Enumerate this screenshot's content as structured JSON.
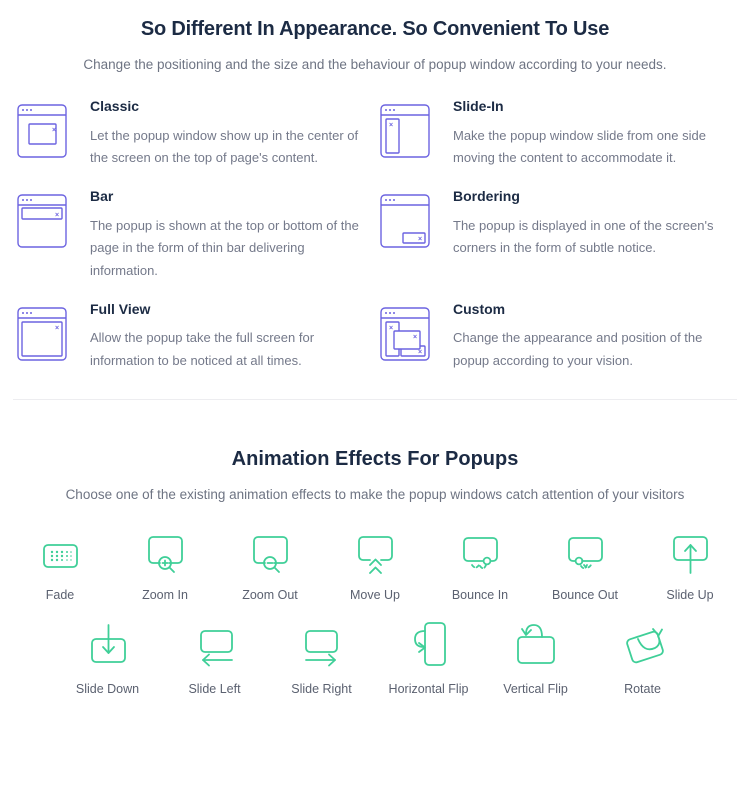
{
  "theme": {
    "icon_blue": "#6c63e0",
    "icon_green": "#3fcf98",
    "heading_color": "#1c2b44",
    "body_color": "#74798a"
  },
  "popup_section": {
    "title": "So Different In Appearance. So Convenient To Use",
    "subtitle": "Change the positioning and the size and the behaviour of popup window according to your needs.",
    "features": [
      {
        "icon": "browser-window-center-popup-icon",
        "title": "Classic",
        "description": "Let the popup window show up in the center of the screen on the top of page's content."
      },
      {
        "icon": "browser-window-side-panel-icon",
        "title": "Slide-In",
        "description": "Make the popup window slide from one side moving the content to accommodate it."
      },
      {
        "icon": "browser-window-top-bar-icon",
        "title": "Bar",
        "description": "The popup is shown at the top or bottom of the page in the form of thin bar delivering information."
      },
      {
        "icon": "browser-window-corner-notice-icon",
        "title": "Bordering",
        "description": "The popup is displayed in one of the screen's corners in the form of subtle notice."
      },
      {
        "icon": "browser-window-fullscreen-icon",
        "title": "Full View",
        "description": "Allow the popup take the full screen for information to be noticed at all times."
      },
      {
        "icon": "browser-window-multi-popup-icon",
        "title": "Custom",
        "description": "Change the appearance and position of the popup according to your vision."
      }
    ]
  },
  "animation_section": {
    "title": "Animation Effects For Popups",
    "subtitle": "Choose one of the existing animation effects to make the popup windows catch attention of your visitors",
    "rows": [
      [
        {
          "icon": "fade-dots-icon",
          "label": "Fade"
        },
        {
          "icon": "zoom-in-magnifier-icon",
          "label": "Zoom In"
        },
        {
          "icon": "zoom-out-magnifier-icon",
          "label": "Zoom Out"
        },
        {
          "icon": "move-up-chevrons-icon",
          "label": "Move Up"
        },
        {
          "icon": "bounce-in-icon",
          "label": "Bounce In"
        },
        {
          "icon": "bounce-out-icon",
          "label": "Bounce Out"
        },
        {
          "icon": "slide-up-arrow-icon",
          "label": "Slide Up"
        }
      ],
      [
        {
          "icon": "slide-down-arrow-icon",
          "label": "Slide Down"
        },
        {
          "icon": "slide-left-arrow-icon",
          "label": "Slide Left"
        },
        {
          "icon": "slide-right-arrow-icon",
          "label": "Slide Right"
        },
        {
          "icon": "horizontal-flip-icon",
          "label": "Horizontal Flip"
        },
        {
          "icon": "vertical-flip-icon",
          "label": "Vertical Flip"
        },
        {
          "icon": "rotate-icon",
          "label": "Rotate"
        }
      ]
    ]
  }
}
